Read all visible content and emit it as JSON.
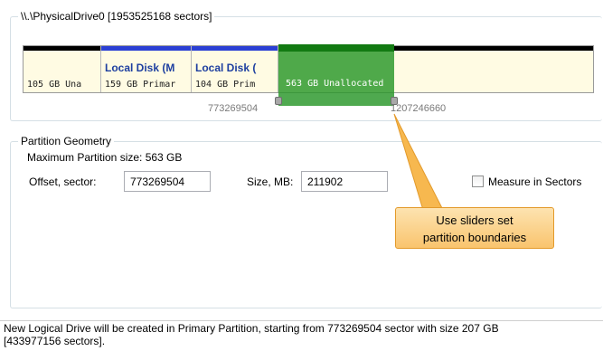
{
  "drive": {
    "title": "\\\\.\\PhysicalDrive0 [1953525168 sectors]",
    "partitions": [
      {
        "name": "",
        "info": "105 GB  Una",
        "bar_color": "#000000"
      },
      {
        "name": "Local Disk (M",
        "info": "159 GB Primar",
        "bar_color": "#2a3fd4"
      },
      {
        "name": "Local Disk (",
        "info": "104 GB Prim",
        "bar_color": "#2a3fd4"
      },
      {
        "name": "",
        "info": "",
        "bar_color": "#000000"
      }
    ],
    "selected": {
      "info": "563 GB  Unallocated",
      "color": "#2e9b2e"
    },
    "slider_start_label": "773269504",
    "slider_end_label": "1207246660"
  },
  "geometry": {
    "title": "Partition Geometry",
    "max_size": "Maximum Partition size: 563 GB",
    "offset_label": "Offset, sector:",
    "offset_value": "773269504",
    "size_label": "Size, MB:",
    "size_value": "211902",
    "measure_label": "Measure in Sectors",
    "measure_checked": false
  },
  "callout": {
    "line1": "Use sliders set",
    "line2": "partition boundaries"
  },
  "status": {
    "line1": "New Logical Drive will be created in Primary Partition, starting from 773269504 sector with size 207 GB",
    "line2": "[433977156 sectors]."
  }
}
